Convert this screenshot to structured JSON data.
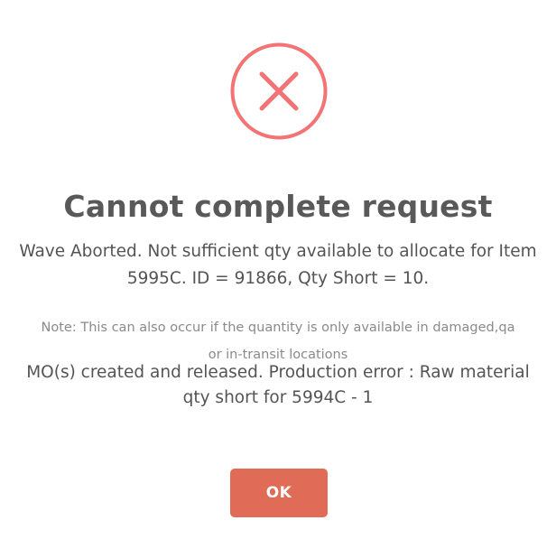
{
  "dialog": {
    "icon": "error-x-icon",
    "title": "Cannot complete request",
    "message": "Wave Aborted. Not sufficient qty available to allocate for Item 5995C. ID = 91866, Qty Short = 10.",
    "note": "Note: This can also occur if the quantity is only available in damaged,qa or in-transit locations",
    "extra": "MO(s) created and released. Production error : Raw material qty short for 5994C - 1",
    "ok_label": "OK"
  },
  "colors": {
    "error": "#f27474",
    "button": "#e06b56",
    "title": "#595959",
    "text": "#545454",
    "note": "#8a8a8a"
  }
}
